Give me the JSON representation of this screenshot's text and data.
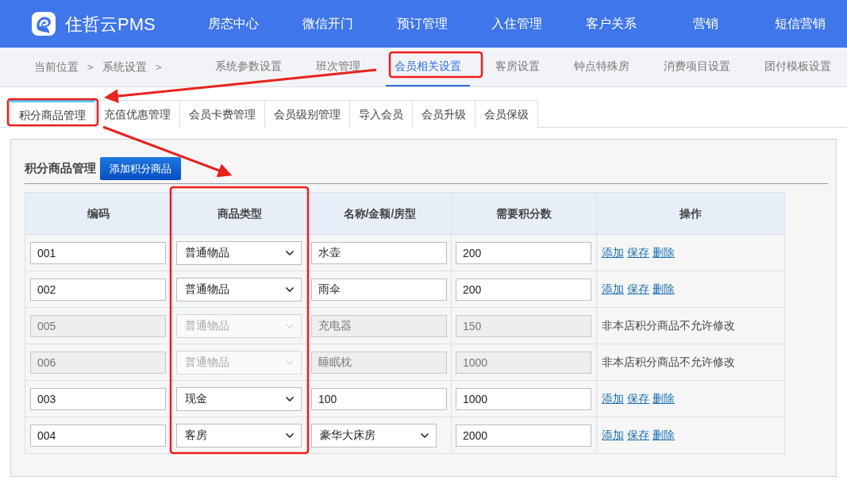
{
  "brand": "住哲云PMS",
  "nav": [
    "房态中心",
    "微信开门",
    "预订管理",
    "入住管理",
    "客户关系",
    "营销",
    "短信营销"
  ],
  "breadcrumb": [
    "当前位置",
    "＞",
    "系统设置",
    "＞"
  ],
  "subnav": [
    {
      "label": "系统参数设置",
      "selected": false
    },
    {
      "label": "班次管理",
      "selected": false
    },
    {
      "label": "会员相关设置",
      "selected": true
    },
    {
      "label": "客房设置",
      "selected": false
    },
    {
      "label": "钟点特殊房",
      "selected": false
    },
    {
      "label": "消费项目设置",
      "selected": false
    },
    {
      "label": "团付模板设置",
      "selected": false
    }
  ],
  "tabs": [
    {
      "label": "积分商品管理",
      "selected": true
    },
    {
      "label": "充值优惠管理",
      "selected": false
    },
    {
      "label": "会员卡费管理",
      "selected": false
    },
    {
      "label": "会员级别管理",
      "selected": false
    },
    {
      "label": "导入会员",
      "selected": false
    },
    {
      "label": "会员升级",
      "selected": false
    },
    {
      "label": "会员保级",
      "selected": false
    }
  ],
  "panel": {
    "title": "积分商品管理",
    "add_button": "添加积分商品"
  },
  "table": {
    "columns": [
      "编码",
      "商品类型",
      "名称/金额/房型",
      "需要积分数",
      "操作"
    ],
    "rows": [
      {
        "code": "001",
        "type": "普通物品",
        "kind": "text",
        "name": "水壶",
        "points": "200",
        "disabled": false,
        "actions": [
          "添加",
          "保存",
          "删除"
        ]
      },
      {
        "code": "002",
        "type": "普通物品",
        "kind": "text",
        "name": "雨伞",
        "points": "200",
        "disabled": false,
        "actions": [
          "添加",
          "保存",
          "删除"
        ]
      },
      {
        "code": "005",
        "type": "普通物品",
        "kind": "text",
        "name": "充电器",
        "points": "150",
        "disabled": true,
        "note": "非本店积分商品不允许修改"
      },
      {
        "code": "006",
        "type": "普通物品",
        "kind": "text",
        "name": "睡眠枕",
        "points": "1000",
        "disabled": true,
        "note": "非本店积分商品不允许修改"
      },
      {
        "code": "003",
        "type": "现金",
        "kind": "text",
        "name": "100",
        "points": "1000",
        "disabled": false,
        "actions": [
          "添加",
          "保存",
          "删除"
        ]
      },
      {
        "code": "004",
        "type": "客房",
        "kind": "select",
        "name": "豪华大床房",
        "points": "2000",
        "disabled": false,
        "actions": [
          "添加",
          "保存",
          "删除"
        ]
      }
    ]
  }
}
